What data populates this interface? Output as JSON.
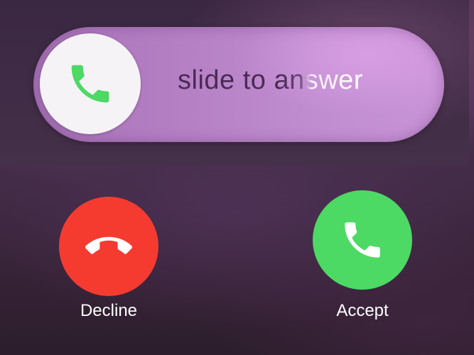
{
  "slider": {
    "label": "slide to answer",
    "knob_icon": "phone-icon"
  },
  "actions": {
    "decline": {
      "label": "Decline",
      "icon": "phone-hangup-icon",
      "color": "#f53b30"
    },
    "accept": {
      "label": "Accept",
      "icon": "phone-icon",
      "color": "#4cd964"
    }
  },
  "colors": {
    "slider_track": "#b57fc4",
    "knob": "#f6f3f6",
    "phone_green": "#4cd964"
  }
}
